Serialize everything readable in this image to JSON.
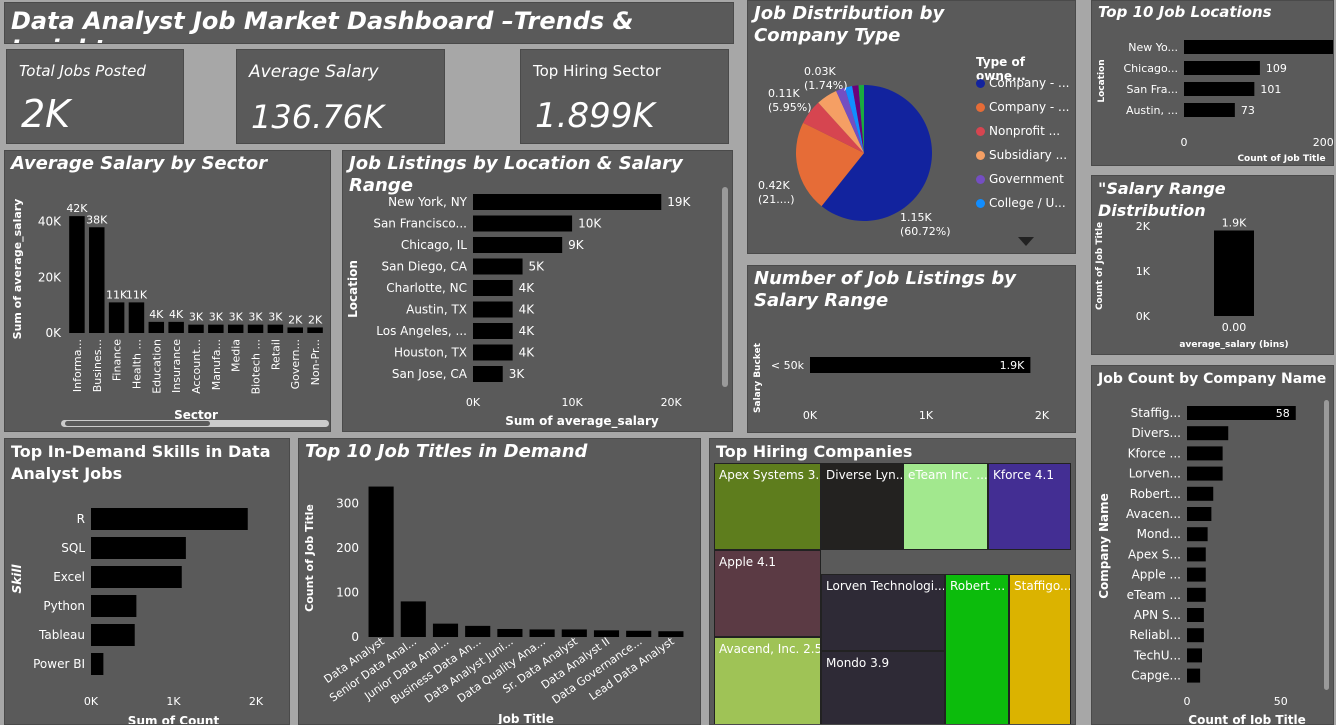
{
  "dashboard_title": "Data Analyst Job Market Dashboard –Trends & Insights",
  "kpis": {
    "total_jobs_label": "Total Jobs Posted",
    "total_jobs_value": "2K",
    "avg_salary_label": "Average Salary",
    "avg_salary_value": "136.76K",
    "top_sector_label": "Top Hiring Sector",
    "top_sector_value": "1.899K"
  },
  "titles": {
    "sector": "Average Salary by Sector",
    "location": "Job Listings by Location & Salary Range",
    "company_type": "Job Distribution by Company Type",
    "buckets": "Number of Job Listings by Salary Range",
    "top_locations": "Top 10 Job Locations",
    "range_dist": "\"Salary Range Distribution",
    "skills": "Top In-Demand Skills in Data Analyst Jobs",
    "titles10": "Top 10 Job Titles in Demand",
    "companies": "Top Hiring Companies",
    "company_name": "Job Count by Company Name"
  },
  "chart_data": [
    {
      "id": "sector",
      "type": "bar",
      "categories": [
        "Informa...",
        "Busines...",
        "Finance",
        "Health ...",
        "Education",
        "Insurance",
        "Account...",
        "Manufa...",
        "Media",
        "Biotech ...",
        "Retail",
        "Govern...",
        "Non-Pr..."
      ],
      "values": [
        42,
        38,
        11,
        11,
        4,
        4,
        3,
        3,
        3,
        3,
        3,
        2,
        2
      ],
      "data_labels": [
        "42K",
        "38K",
        "11K",
        "11K",
        "4K",
        "4K",
        "3K",
        "3K",
        "3K",
        "3K",
        "3K",
        "2K",
        "2K"
      ],
      "xlabel": "Sector",
      "ylabel": "Sum of average_salary",
      "ticks": [
        "0K",
        "20K",
        "40K"
      ],
      "tick_values": [
        0,
        20,
        40
      ],
      "ylim": [
        0,
        46
      ]
    },
    {
      "id": "location",
      "type": "bar",
      "categories": [
        "New York, NY",
        "San Francisco...",
        "Chicago, IL",
        "San Diego, CA",
        "Charlotte, NC",
        "Austin, TX",
        "Los Angeles, ...",
        "Houston, TX",
        "San Jose, CA"
      ],
      "values": [
        19,
        10,
        9,
        5,
        4,
        4,
        4,
        4,
        3
      ],
      "data_labels": [
        "19K",
        "10K",
        "9K",
        "5K",
        "4K",
        "4K",
        "4K",
        "4K",
        "3K"
      ],
      "xlabel": "Sum of average_salary",
      "ylabel": "Location",
      "ticks": [
        "0K",
        "10K",
        "20K"
      ],
      "tick_values": [
        0,
        10,
        20
      ],
      "xlim": [
        0,
        22
      ]
    },
    {
      "id": "company_type",
      "type": "pie",
      "slices": [
        {
          "name": "Company - ...",
          "value": 60.72,
          "color": "#12239e"
        },
        {
          "name": "Company - ...",
          "value": 21.6,
          "color": "#e66c37"
        },
        {
          "name": "Nonprofit ...",
          "value": 5.95,
          "color": "#d64550"
        },
        {
          "name": "Subsidiary ...",
          "value": 5.0,
          "color": "#f59f64"
        },
        {
          "name": "Government",
          "value": 2.2,
          "color": "#744ec2"
        },
        {
          "name": "College / U...",
          "value": 1.74,
          "color": "#118dff"
        },
        {
          "name": "",
          "value": 1.5,
          "color": "#6b007b"
        },
        {
          "name": "",
          "value": 1.29,
          "color": "#1aab40"
        }
      ],
      "legend_title": "Type of owne...",
      "data_labels": [
        {
          "value": "1.15K",
          "pct": "(60.72%)"
        },
        {
          "value": "0.42K",
          "pct": "(21....)"
        },
        {
          "value": "0.11K",
          "pct": "(5.95%)"
        },
        {
          "value": "0.03K",
          "pct": "(1.74%)"
        }
      ]
    },
    {
      "id": "buckets",
      "type": "bar",
      "categories": [
        "< 50k"
      ],
      "values": [
        1.9
      ],
      "data_labels": [
        "1.9K"
      ],
      "ylabel": "Salary Bucket",
      "ticks": [
        "0K",
        "1K",
        "2K"
      ],
      "tick_values": [
        0,
        1,
        2
      ],
      "xlim": [
        0,
        2
      ]
    },
    {
      "id": "top_locations",
      "type": "bar",
      "categories": [
        "New Yo...",
        "Chicago...",
        "San Fra...",
        "Austin, ..."
      ],
      "values": [
        260,
        109,
        101,
        73
      ],
      "xlabel": "Count of Job Title",
      "ylabel": "Location",
      "ticks": [
        "0",
        "200"
      ],
      "tick_values": [
        0,
        200
      ],
      "xlim": [
        0,
        280
      ]
    },
    {
      "id": "range_dist",
      "type": "bar",
      "categories": [
        "0.00"
      ],
      "values": [
        1.9
      ],
      "data_labels": [
        "1.9K"
      ],
      "xlabel": "average_salary (bins)",
      "ylabel": "Count of Job Title",
      "ticks": [
        "0K",
        "1K",
        "2K"
      ],
      "tick_values": [
        0,
        1,
        2
      ],
      "ylim": [
        0,
        2
      ]
    },
    {
      "id": "skills",
      "type": "bar",
      "categories": [
        "R",
        "SQL",
        "Excel",
        "Python",
        "Tableau",
        "Power BI"
      ],
      "values": [
        1.9,
        1.15,
        1.1,
        0.55,
        0.53,
        0.15
      ],
      "xlabel": "Sum of Count",
      "ylabel": "Skill",
      "ticks": [
        "0K",
        "1K",
        "2K"
      ],
      "tick_values": [
        0,
        1,
        2
      ],
      "xlim": [
        0,
        2
      ]
    },
    {
      "id": "titles10",
      "type": "bar",
      "categories": [
        "Data Analyst",
        "Senior Data Anal...",
        "Junior Data Anal...",
        "Business Data An...",
        "Data Analyst Juni...",
        "Data Quality Ana...",
        "Sr. Data Analyst",
        "Data Analyst II",
        "Data Governance...",
        "Lead Data Analyst"
      ],
      "values": [
        338,
        80,
        30,
        25,
        18,
        17,
        17,
        15,
        14,
        13
      ],
      "xlabel": "Job Title",
      "ylabel": "Count of Job Title",
      "ticks": [
        "0",
        "100",
        "200",
        "300"
      ],
      "tick_values": [
        0,
        100,
        200,
        300
      ],
      "ylim": [
        0,
        355
      ]
    },
    {
      "id": "companies",
      "type": "treemap",
      "items": [
        {
          "label": "Apex Systems 3.8",
          "color": "#5e7d1d"
        },
        {
          "label": "Apple 4.1",
          "color": "#5b3a44"
        },
        {
          "label": "Avacend, Inc. 2.5",
          "color": "#9fc356"
        },
        {
          "label": "Diverse Lyn...",
          "color": "#232220"
        },
        {
          "label": "eTeam Inc. ...",
          "color": "#a2e88e"
        },
        {
          "label": "Kforce 4.1",
          "color": "#432e93"
        },
        {
          "label": "Lorven Technologi...",
          "color": "#2e2a36"
        },
        {
          "label": "Robert ...",
          "color": "#0cbc0c"
        },
        {
          "label": "Staffigo...",
          "color": "#dbb300"
        },
        {
          "label": "Mondo 3.9",
          "color": "#2e2a36"
        }
      ]
    },
    {
      "id": "company_name",
      "type": "bar",
      "categories": [
        "Staffig...",
        "Divers...",
        "Kforce ...",
        "Lorven...",
        "Robert...",
        "Avacen...",
        "Mond...",
        "Apex S...",
        "Apple ...",
        "eTeam ...",
        "APN S...",
        "Reliabl...",
        "TechU...",
        "Capge..."
      ],
      "values": [
        58,
        22,
        19,
        19,
        14,
        13,
        11,
        10,
        10,
        10,
        9,
        9,
        8,
        7
      ],
      "data_labels": [
        "58"
      ],
      "xlabel": "Count of Job Title",
      "ylabel": "Company Name",
      "ticks": [
        "0",
        "50"
      ],
      "tick_values": [
        0,
        50
      ],
      "xlim": [
        0,
        64
      ]
    }
  ]
}
